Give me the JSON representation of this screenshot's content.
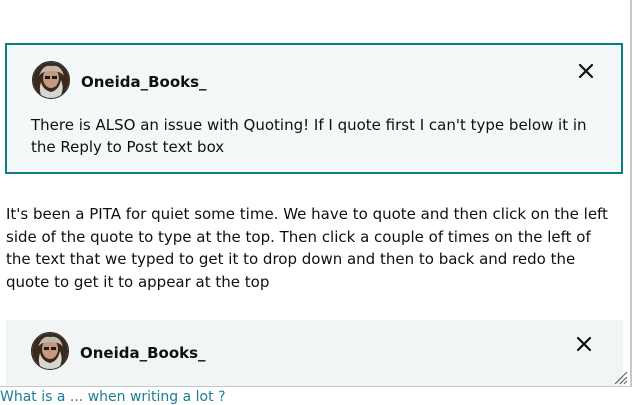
{
  "quote_one": {
    "author": "Oneida_Books_",
    "text": "There is ALSO an issue with Quoting! If I quote first I can't type below it in the Reply to Post text box"
  },
  "body_text": "It's been a PITA for quiet some time. We have to quote and then  click on the left side of the quote to type at the top. Then click a couple of times on the left of the text that we typed to get it to drop down and then to back and redo the quote to get it to appear at the top",
  "quote_two": {
    "author": "Oneida_Books_"
  },
  "bottom_link": "What is a ... when writing a lot ? ",
  "colors": {
    "quote_border": "#0f7c86",
    "link": "#1a7e99"
  }
}
